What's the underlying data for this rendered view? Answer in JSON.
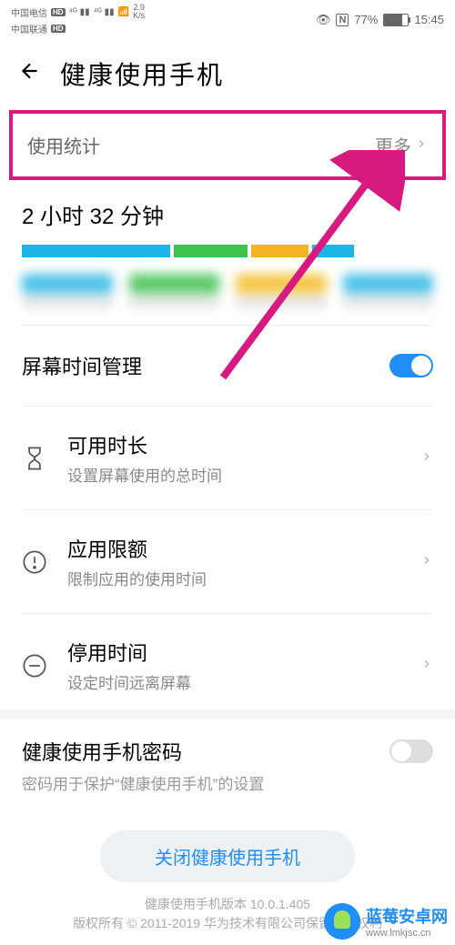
{
  "status": {
    "carrier1": "中国电信",
    "carrier2": "中国联通",
    "net_speed_val": "2.9",
    "net_speed_unit": "K/s",
    "nfc": "N",
    "battery_pct": "77%",
    "time": "15:45"
  },
  "header": {
    "title": "健康使用手机"
  },
  "usage": {
    "stats_label": "使用统计",
    "more_label": "更多",
    "duration": "2 小时 32 分钟"
  },
  "chart_data": {
    "type": "bar",
    "title": "使用统计",
    "total_label": "2 小时 32 分钟",
    "segments": [
      {
        "color": "#1bb6e6",
        "proportion": 0.36
      },
      {
        "color": "#3fc24f",
        "proportion": 0.18
      },
      {
        "color": "#f5b423",
        "proportion": 0.14
      },
      {
        "color": "#1bb6e6",
        "proportion": 0.1
      }
    ]
  },
  "screen_time": {
    "label": "屏幕时间管理",
    "enabled": true
  },
  "settings": [
    {
      "icon": "hourglass",
      "title": "可用时长",
      "desc": "设置屏幕使用的总时间"
    },
    {
      "icon": "alert",
      "title": "应用限额",
      "desc": "限制应用的使用时间"
    },
    {
      "icon": "minus",
      "title": "停用时间",
      "desc": "设定时间远离屏幕"
    }
  ],
  "password": {
    "title": "健康使用手机密码",
    "desc": "密码用于保护“健康使用手机”的设置",
    "enabled": false
  },
  "close_btn": "关闭健康使用手机",
  "footer": {
    "version": "健康使用手机版本 10.0.1.405",
    "copyright": "版权所有 © 2011-2019 华为技术有限公司保留一切权利"
  },
  "watermark": {
    "title": "蓝莓安卓网",
    "url": "www.lmkjsc.cn"
  }
}
